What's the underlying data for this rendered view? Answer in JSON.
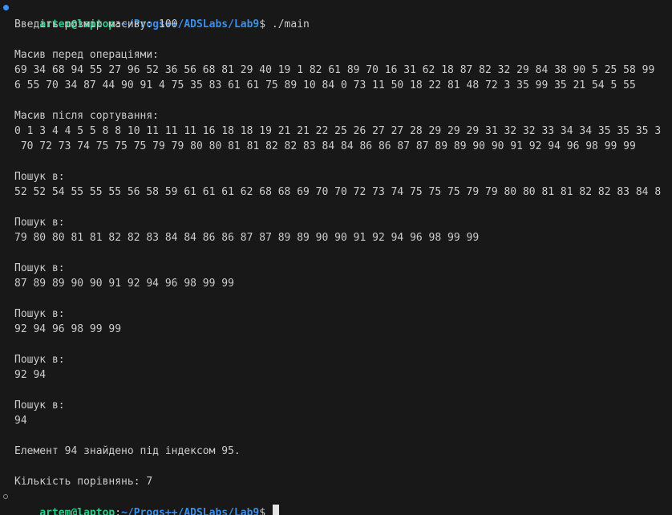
{
  "prompt": {
    "user_host": "artem@laptop",
    "colon": ":",
    "path": "~/Progs++/ADSLabs/Lab9",
    "symbol": "$",
    "command": " ./main"
  },
  "output": {
    "size_prompt": "Введіть розмір масиву: 100",
    "before_title": "Масив перед операціями:",
    "before_line1": "69 34 68 94 55 27 96 52 36 56 68 81 29 40 19 1 82 61 89 70 16 31 62 18 87 82 32 29 84 38 90 5 25 58 99",
    "before_line2": "6 55 70 34 87 44 90 91 4 75 35 83 61 61 75 89 10 84 0 73 11 50 18 22 81 48 72 3 35 99 35 21 54 5 55",
    "after_title": "Масив після сортування:",
    "after_line1": "0 1 3 4 4 5 5 8 8 10 11 11 11 16 18 18 19 21 21 22 25 26 27 27 28 29 29 29 31 32 32 33 34 34 35 35 35 3",
    "after_line2": " 70 72 73 74 75 75 75 79 79 80 80 81 81 82 82 83 84 84 86 86 87 87 89 89 90 90 91 92 94 96 98 99 99",
    "searches": [
      {
        "title": "Пошук в:",
        "values": "52 52 54 55 55 55 56 58 59 61 61 61 62 68 68 69 70 70 72 73 74 75 75 75 79 79 80 80 81 81 82 82 83 84 8"
      },
      {
        "title": "Пошук в:",
        "values": "79 80 80 81 81 82 82 83 84 84 86 86 87 87 89 89 90 90 91 92 94 96 98 99 99"
      },
      {
        "title": "Пошук в:",
        "values": "87 89 89 90 90 91 92 94 96 98 99 99"
      },
      {
        "title": "Пошук в:",
        "values": "92 94 96 98 99 99"
      },
      {
        "title": "Пошук в:",
        "values": "92 94"
      },
      {
        "title": "Пошук в:",
        "values": "94"
      }
    ],
    "found": "Елемент 94 знайдено під індексом 95.",
    "comparisons": "Кількість порівнянь: 7"
  },
  "colors": {
    "background": "#181818",
    "text": "#cccccc",
    "user_host": "#23d18b",
    "path": "#3b8eea",
    "marker_success": "#3794ff"
  }
}
